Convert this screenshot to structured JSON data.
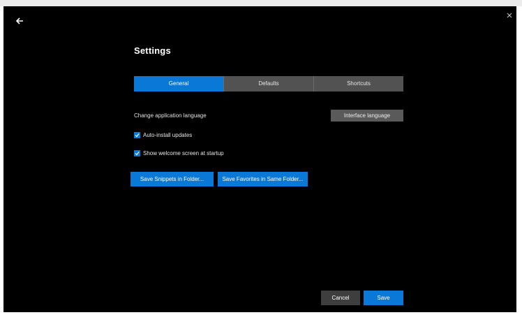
{
  "window": {
    "title": "Settings"
  },
  "tabs": [
    {
      "label": "General",
      "active": true
    },
    {
      "label": "Defaults",
      "active": false
    },
    {
      "label": "Shortcuts",
      "active": false
    }
  ],
  "language": {
    "label": "Change application language",
    "button_label": "Interface language"
  },
  "checkboxes": [
    {
      "label": "Auto-install updates",
      "checked": true
    },
    {
      "label": "Show welcome screen at startup",
      "checked": true
    }
  ],
  "actions": {
    "folder_a": "Save Snippets in Folder...",
    "folder_b": "Save Favorites in Same Folder..."
  },
  "footer": {
    "cancel_label": "Cancel",
    "save_label": "Save"
  },
  "colors": {
    "accent": "#0a78d6",
    "background": "#000000",
    "tab_inactive": "#525252"
  }
}
